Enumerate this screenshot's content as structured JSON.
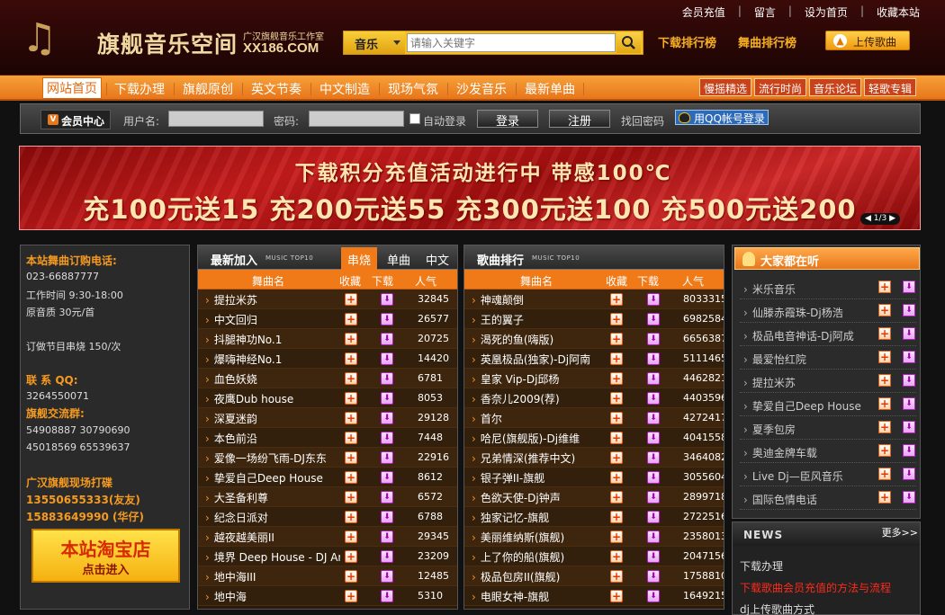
{
  "header": {
    "logo_title": "旗舰音乐空间",
    "logo_sub": "广汉旗舰音乐工作室",
    "logo_domain": "XX186.COM",
    "top_links": [
      "会员充值",
      "留言",
      "设为首页",
      "收藏本站"
    ],
    "search_category": "音乐",
    "search_placeholder": "请输入关键字",
    "link_download_rank": "下载排行榜",
    "link_dance_rank": "舞曲排行榜",
    "upload_label": "上传歌曲"
  },
  "nav": {
    "items": [
      "网站首页",
      "下载办理",
      "旗舰原创",
      "英文节奏",
      "中文制造",
      "现场气氛",
      "沙发音乐",
      "最新单曲"
    ],
    "pills": [
      "慢摇精选",
      "流行时尚",
      "音乐论坛",
      "轻歌专辑"
    ]
  },
  "login": {
    "vip_label": "会员中心",
    "username_label": "用户名:",
    "password_label": "密码:",
    "auto_login": "自动登录",
    "login_btn": "登录",
    "register_btn": "注册",
    "find_password": "找回密码",
    "qq_login": "用QQ帐号登录"
  },
  "banner": {
    "line1": "下载积分充值活动进行中  带感100℃",
    "line2": "充100元送15  充200元送55  充300元送100  充500元送200",
    "pager": "1/3"
  },
  "info": {
    "phone_title": "本站舞曲订购电话:",
    "phone": "023-66887777",
    "hours": "工作时间 9:30-18:00",
    "price": "原音质 30元/首",
    "custom_price": "订做节目串烧 150/次",
    "qq_title": "联 系 QQ:",
    "qq": "3264550071",
    "group_title": "旗舰交流群:",
    "groups1": "54908887  30790690",
    "groups2": "45018569  65539637",
    "live_title": "广汉旗舰现场打碟",
    "live1": "13550655333(友友)",
    "live2": "15883649990 (华仔)",
    "shop_t1": "本站淘宝店",
    "shop_t2": "点击进入"
  },
  "latest": {
    "title": "最新加入",
    "title_en": "MUSIC TOP10",
    "tabs": [
      "串烧",
      "单曲",
      "中文"
    ],
    "col_name": "舞曲名",
    "col_fav": "收藏",
    "col_dl": "下载",
    "col_pop": "人气",
    "rows": [
      {
        "name": "提拉米苏",
        "pop": "32845"
      },
      {
        "name": "中文回归",
        "pop": "26577"
      },
      {
        "name": "抖腿神功No.1",
        "pop": "20725"
      },
      {
        "name": "爆嗨神经No.1",
        "pop": "14420"
      },
      {
        "name": "血色妖娆",
        "pop": "6781"
      },
      {
        "name": "夜鹰Dub house",
        "pop": "8053"
      },
      {
        "name": "深夏迷韵",
        "pop": "29128"
      },
      {
        "name": "本色前沿",
        "pop": "7448"
      },
      {
        "name": "爱像一场纷飞雨-DJ东东",
        "pop": "22916"
      },
      {
        "name": "挚爱自己Deep House",
        "pop": "8612"
      },
      {
        "name": "大圣备利尊",
        "pop": "6572"
      },
      {
        "name": "纪念日派对",
        "pop": "6788"
      },
      {
        "name": "越夜越美丽II",
        "pop": "29345"
      },
      {
        "name": "境界 Deep House - DJ Ana",
        "pop": "23209"
      },
      {
        "name": "地中海III",
        "pop": "12485"
      },
      {
        "name": "地中海",
        "pop": "5310"
      }
    ]
  },
  "ranking": {
    "title": "歌曲排行",
    "title_en": "MUSIC TOP10",
    "col_name": "舞曲名",
    "col_fav": "收藏",
    "col_dl": "下载",
    "col_pop": "人气",
    "rows": [
      {
        "name": "神魂颠倒",
        "pop": "8033315"
      },
      {
        "name": "王的翼子",
        "pop": "6982584"
      },
      {
        "name": "渴死的鱼(嗨版)",
        "pop": "6656387"
      },
      {
        "name": "英凰极品(独家)-Dj阿南",
        "pop": "5111465"
      },
      {
        "name": "皇家 Vip-Dj邱杨",
        "pop": "4462821"
      },
      {
        "name": "香奈儿2009(荐)",
        "pop": "4403596"
      },
      {
        "name": "首尔",
        "pop": "4272417"
      },
      {
        "name": "哈尼(旗舰版)-Dj维维",
        "pop": "4041558"
      },
      {
        "name": "兄弟情深(推荐中文)",
        "pop": "3464082"
      },
      {
        "name": "银子弹II-旗舰",
        "pop": "3055604"
      },
      {
        "name": "色欲天使-Dj钟声",
        "pop": "2899718"
      },
      {
        "name": "独家记忆-旗舰",
        "pop": "2722516"
      },
      {
        "name": "美丽维纳斯(旗舰)",
        "pop": "2358013"
      },
      {
        "name": "上了你的船(旗舰)",
        "pop": "2047156"
      },
      {
        "name": "极品包房II(旗舰)",
        "pop": "1758810"
      },
      {
        "name": "电眼女神-旗舰",
        "pop": "1649215"
      }
    ]
  },
  "listening": {
    "title": "大家都在听",
    "items": [
      "米乐音乐",
      "仙滕赤霞珠-Dj杨浩",
      "极品电音神话-Dj阿成",
      "最爱怡红院",
      "提拉米苏",
      "挚爱自己Deep House",
      "夏季包房",
      "奥迪金牌车载",
      "Live Dj—臣风音乐",
      "国际色情电话"
    ]
  },
  "news": {
    "title": "NEWS",
    "more": "更多>>",
    "items": [
      "下载办理",
      "下载歌曲会员充值的方法与流程",
      "dj上传歌曲方式"
    ]
  },
  "colors": {
    "accent_orange": "#f07a18",
    "header_bg": "#2a0806",
    "link_gold": "#f6b020",
    "news_red": "#ff2a1a"
  }
}
